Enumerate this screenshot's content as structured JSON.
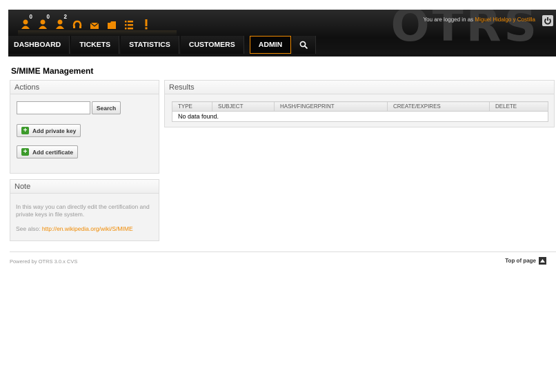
{
  "header": {
    "logo_text": "OTRS",
    "user_prefix": "You are logged in as ",
    "user_name": "Miguel Hidalgo y Costilla",
    "toolbar": [
      {
        "icon": "locked-tickets-icon",
        "count": "0"
      },
      {
        "icon": "watched-tickets-icon",
        "count": "0"
      },
      {
        "icon": "responsible-tickets-icon",
        "count": "2"
      },
      {
        "icon": "phone-ticket-icon",
        "count": ""
      },
      {
        "icon": "email-ticket-icon",
        "count": ""
      },
      {
        "icon": "customer-folder-icon",
        "count": ""
      },
      {
        "icon": "queue-list-icon",
        "count": ""
      },
      {
        "icon": "escalation-icon",
        "count": ""
      }
    ]
  },
  "nav": {
    "items": [
      "DASHBOARD",
      "TICKETS",
      "STATISTICS",
      "CUSTOMERS",
      "ADMIN"
    ],
    "active": "ADMIN"
  },
  "page": {
    "title": "S/MIME Management"
  },
  "actions": {
    "heading": "Actions",
    "search_value": "",
    "search_label": "Search",
    "add_private_key_label": "Add private key",
    "add_certificate_label": "Add certificate"
  },
  "note": {
    "heading": "Note",
    "text": "In this way you can directly edit the certification and private keys in file system.",
    "see_also": "See also: ",
    "link": "http://en.wikipedia.org/wiki/S/MIME"
  },
  "results": {
    "heading": "Results",
    "columns": [
      "TYPE",
      "SUBJECT",
      "HASH/FINGERPRINT",
      "CREATE/EXPIRES",
      "DELETE"
    ],
    "empty_text": "No data found."
  },
  "footer": {
    "powered_by": "Powered by OTRS 3.0.x CVS",
    "top_of_page": "Top of page"
  },
  "colors": {
    "accent": "#f08a00",
    "header_bg": "#151515",
    "add_green": "#3c9a2b"
  }
}
